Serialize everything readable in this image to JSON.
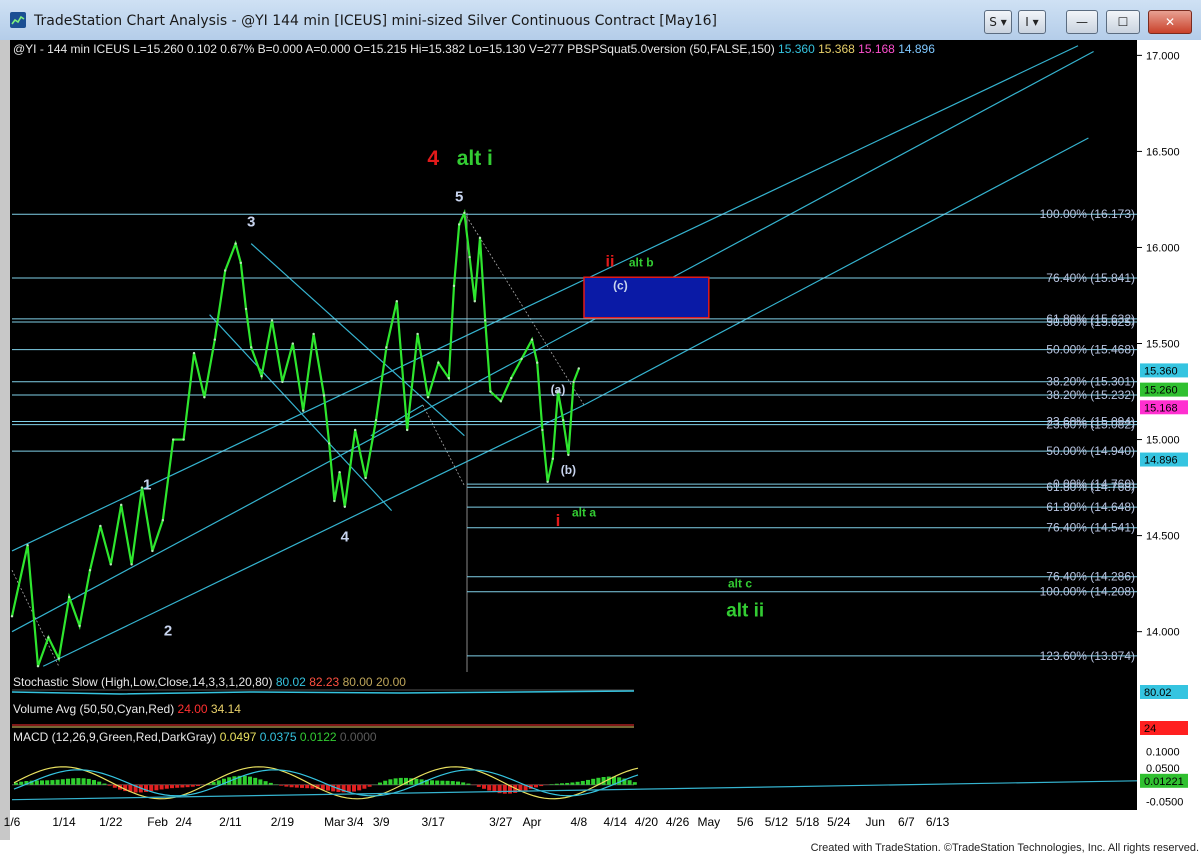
{
  "window": {
    "title": "TradeStation Chart Analysis - @YI 144 min [ICEUS] mini-sized Silver Continuous Contract [May16]",
    "buttons": [
      {
        "name": "strategy-s-button",
        "label": "S"
      },
      {
        "name": "indicator-i-button",
        "label": "I"
      },
      {
        "name": "minimize-button",
        "label": "—"
      },
      {
        "name": "maximize-button",
        "label": "☐"
      },
      {
        "name": "close-button",
        "label": "✕"
      }
    ]
  },
  "colors": {
    "background": "#000000",
    "price": "#2ee62e",
    "channel": "#35b3cf",
    "fib": "#80d0e8",
    "gold": "#bfa65a",
    "wave_white": "#c8d4ee",
    "wave_red": "#e21a1a",
    "wave_green": "#33cc33",
    "box_fill": "#0a1aa6",
    "box_border": "#e21a1a"
  },
  "header_line": [
    {
      "text": "@YI - 144 min  ICEUS  L=15.260  0.102  0.67%  B=0.000  A=0.000  O=15.215  Hi=15.382  Lo=15.130  V=277  PBSPSquat5.0version (50,FALSE,150)",
      "color": "#e8e8e8"
    },
    {
      "text": "15.360",
      "color": "#35c4e0"
    },
    {
      "text": "15.368",
      "color": "#e8d06a"
    },
    {
      "text": "15.168",
      "color": "#ff4fcf"
    },
    {
      "text": "14.896",
      "color": "#7fc8ff"
    }
  ],
  "price_axis": {
    "ticks": [
      "17.000",
      "16.500",
      "16.000",
      "15.500",
      "15.000",
      "14.500",
      "14.000"
    ],
    "flags": [
      {
        "label": "15.360",
        "value": 15.36,
        "bg": "#35c4e0",
        "fg": "#000000"
      },
      {
        "label": "15.260",
        "value": 15.26,
        "bg": "#30c030",
        "fg": "#000000"
      },
      {
        "label": "15.168",
        "value": 15.168,
        "bg": "#ff2fd0",
        "fg": "#000000"
      },
      {
        "label": "14.896",
        "value": 14.896,
        "bg": "#35c4e0",
        "fg": "#000000"
      }
    ]
  },
  "fib_levels": [
    {
      "label": "100.00% (16.173)",
      "value": 16.173
    },
    {
      "label": "76.40% (15.841)",
      "value": 15.841
    },
    {
      "label": "61.80% (15.632)",
      "value": 15.628
    },
    {
      "label": "50.00% (15.625)",
      "value": 15.612
    },
    {
      "label": "50.00% (15.468)",
      "value": 15.468
    },
    {
      "label": "38.20% (15.301)",
      "value": 15.301
    },
    {
      "label": "38.20% (15.232)",
      "value": 15.232
    },
    {
      "label": "23.60% (15.094)",
      "value": 15.094
    },
    {
      "label": "23.60% (15.082)",
      "value": 15.078
    },
    {
      "label": "50.00% (14.940)",
      "value": 14.94
    },
    {
      "label": "0.00% (14.760)",
      "value": 14.768
    },
    {
      "label": "61.80% (14.768)",
      "value": 14.752
    },
    {
      "label": "61.80% (14.648)",
      "value": 14.648
    },
    {
      "label": "76.40% (14.541)",
      "value": 14.541
    },
    {
      "label": "76.40% (14.286)",
      "value": 14.286
    },
    {
      "label": "100.00% (14.208)",
      "value": 14.208
    },
    {
      "label": "123.60% (13.874)",
      "value": 13.874
    }
  ],
  "wave_labels": [
    {
      "text": "1",
      "date_index": 26,
      "value": 14.74,
      "color": "wave_white",
      "size": 15
    },
    {
      "text": "2",
      "date_index": 30,
      "value": 13.98,
      "color": "wave_white",
      "size": 15
    },
    {
      "text": "3",
      "date_index": 46,
      "value": 16.11,
      "color": "wave_white",
      "size": 15
    },
    {
      "text": "4",
      "date_index": 64,
      "value": 14.47,
      "color": "wave_white",
      "size": 15
    },
    {
      "text": "5",
      "date_index": 86,
      "value": 16.24,
      "color": "wave_white",
      "size": 15
    },
    {
      "text": "4",
      "date_index": 81,
      "value": 16.43,
      "color": "wave_red",
      "size": 21
    },
    {
      "text": "alt i",
      "date_index": 89,
      "value": 16.43,
      "color": "wave_green",
      "size": 21
    },
    {
      "text": "ii",
      "date_index": 115,
      "value": 15.9,
      "color": "wave_red",
      "size": 16
    },
    {
      "text": "alt b",
      "date_index": 121,
      "value": 15.9,
      "color": "wave_green",
      "size": 12
    },
    {
      "text": "(c)",
      "date_index": 117,
      "value": 15.78,
      "color": "wave_white",
      "size": 12
    },
    {
      "text": "(a)",
      "date_index": 105,
      "value": 15.24,
      "color": "wave_white",
      "size": 12
    },
    {
      "text": "(b)",
      "date_index": 107,
      "value": 14.82,
      "color": "wave_white",
      "size": 12
    },
    {
      "text": "i",
      "date_index": 105,
      "value": 14.55,
      "color": "wave_red",
      "size": 17
    },
    {
      "text": "alt a",
      "date_index": 110,
      "value": 14.6,
      "color": "wave_green",
      "size": 12
    },
    {
      "text": "alt c",
      "date_index": 140,
      "value": 14.23,
      "color": "wave_green",
      "size": 12
    },
    {
      "text": "alt ii",
      "date_index": 141,
      "value": 14.08,
      "color": "wave_green",
      "size": 19
    }
  ],
  "resistance_box": {
    "from_index": 110,
    "to_index": 134,
    "low": 15.634,
    "high": 15.845
  },
  "indicators": {
    "stochastic": {
      "label": "Stochastic Slow (High,Low,Close,14,3,3,1,20,80)",
      "values": [
        {
          "text": "80.02",
          "color": "#35c4e0"
        },
        {
          "text": "82.23",
          "color": "#ff5040"
        },
        {
          "text": "80.00",
          "color": "#bfa65a"
        },
        {
          "text": "20.00",
          "color": "#bfa65a"
        }
      ],
      "flag": {
        "label": "80.02",
        "bg": "#35c4e0"
      }
    },
    "volume": {
      "label": "Volume Avg (50,50,Cyan,Red)",
      "values": [
        {
          "text": "24.00",
          "color": "#ff3030"
        },
        {
          "text": "34.14",
          "color": "#e8d06a"
        }
      ],
      "flag": {
        "label": "24",
        "bg": "#ff2020"
      }
    },
    "macd": {
      "label": "MACD (12,26,9,Green,Red,DarkGray)",
      "values": [
        {
          "text": "0.0497",
          "color": "#e8e060"
        },
        {
          "text": "0.0375",
          "color": "#35c4e0"
        },
        {
          "text": "0.0122",
          "color": "#33cc33"
        },
        {
          "text": "0.0000",
          "color": "#5a5a5a"
        }
      ],
      "ticks": [
        "0.1000",
        "0.0500",
        "-0.0500"
      ],
      "flag": {
        "label": "0.01221",
        "bg": "#30c030"
      }
    }
  },
  "x_axis": {
    "labels": [
      {
        "text": "1/6",
        "date_index": 0
      },
      {
        "text": "1/14",
        "date_index": 10
      },
      {
        "text": "1/22",
        "date_index": 19
      },
      {
        "text": "Feb",
        "date_index": 28
      },
      {
        "text": "2/4",
        "date_index": 33
      },
      {
        "text": "2/11",
        "date_index": 42
      },
      {
        "text": "2/19",
        "date_index": 52
      },
      {
        "text": "Mar",
        "date_index": 62
      },
      {
        "text": "3/4",
        "date_index": 66
      },
      {
        "text": "3/9",
        "date_index": 71
      },
      {
        "text": "3/17",
        "date_index": 81
      },
      {
        "text": "3/27",
        "date_index": 94
      },
      {
        "text": "Apr",
        "date_index": 100
      },
      {
        "text": "4/8",
        "date_index": 109
      },
      {
        "text": "4/14",
        "date_index": 116
      },
      {
        "text": "4/20",
        "date_index": 122
      },
      {
        "text": "4/26",
        "date_index": 128
      },
      {
        "text": "May",
        "date_index": 134
      },
      {
        "text": "5/6",
        "date_index": 141
      },
      {
        "text": "5/12",
        "date_index": 147
      },
      {
        "text": "5/18",
        "date_index": 153
      },
      {
        "text": "5/24",
        "date_index": 159
      },
      {
        "text": "Jun",
        "date_index": 166
      },
      {
        "text": "6/7",
        "date_index": 172
      },
      {
        "text": "6/13",
        "date_index": 178
      }
    ]
  },
  "chart_data": {
    "type": "line",
    "title": "@YI 144 min [ICEUS] mini-sized Silver Continuous Contract [May16]",
    "xlabel": "",
    "ylabel": "",
    "ylim": [
      13.79,
      17.08
    ],
    "series": [
      {
        "name": "@YI - 144 min",
        "x_index": [
          0,
          3,
          5,
          7,
          9,
          11,
          13,
          15,
          17,
          19,
          21,
          23,
          25,
          27,
          29,
          31,
          33,
          35,
          37,
          39,
          41,
          43,
          44,
          45,
          46,
          48,
          50,
          52,
          54,
          56,
          58,
          60,
          61,
          62,
          63,
          64,
          66,
          68,
          70,
          72,
          74,
          76,
          78,
          80,
          82,
          84,
          85,
          86,
          87,
          88,
          89,
          90,
          91,
          92,
          94,
          96,
          98,
          100,
          101,
          102,
          103,
          104,
          105,
          106,
          107,
          108,
          109
        ],
        "values": [
          14.08,
          14.45,
          13.82,
          13.97,
          13.86,
          14.18,
          14.03,
          14.32,
          14.55,
          14.35,
          14.66,
          14.35,
          14.75,
          14.42,
          14.58,
          15.0,
          15.0,
          15.45,
          15.22,
          15.52,
          15.88,
          16.02,
          15.92,
          15.68,
          15.48,
          15.33,
          15.62,
          15.3,
          15.5,
          15.15,
          15.55,
          15.23,
          14.98,
          14.68,
          14.83,
          14.65,
          15.05,
          14.8,
          15.1,
          15.48,
          15.72,
          15.05,
          15.55,
          15.22,
          15.4,
          15.32,
          15.8,
          16.12,
          16.18,
          15.95,
          15.72,
          16.05,
          15.62,
          15.25,
          15.2,
          15.32,
          15.42,
          15.52,
          15.4,
          15.05,
          14.78,
          14.9,
          15.25,
          15.1,
          14.92,
          15.3,
          15.37
        ]
      }
    ]
  },
  "footer": {
    "credit": "Created with TradeStation. ©TradeStation Technologies, Inc. All rights reserved."
  }
}
